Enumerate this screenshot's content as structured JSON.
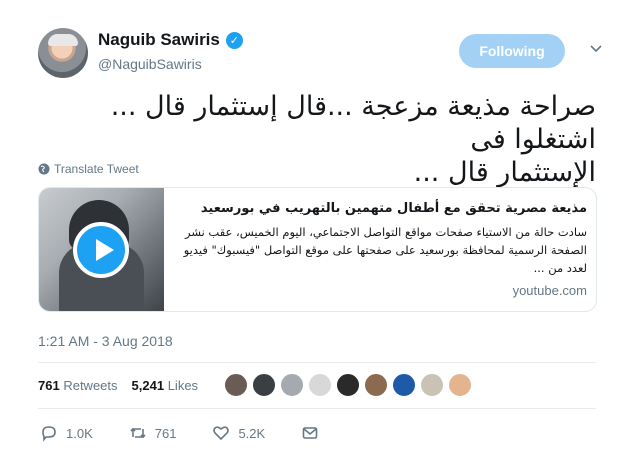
{
  "tweet": {
    "author": {
      "display_name": "Naguib Sawiris",
      "handle": "@NaguibSawiris",
      "verified": true
    },
    "follow_button_label": "Following",
    "text_line1": "صراحة مذيعة مزعجة ...قال إستثمار قال ... اشتغلوا فى",
    "text_line2": "الإستثمار قال ...",
    "translate_label": "Translate Tweet",
    "card": {
      "title": "مذيعة مصرية تحقق مع أطفال متهمين بالتهريب في بورسعيد",
      "description": "سادت حالة من الاستياء صفحات مواقع التواصل الاجتماعي، اليوم الخميس، عقب نشر الصفحة الرسمية لمحافظة بورسعيد على صفحتها على موقع التواصل \"فيسبوك\" فيديو لعدد من ...",
      "domain": "youtube.com"
    },
    "timestamp": "1:21 AM - 3 Aug 2018",
    "stats": {
      "retweets_count": "761",
      "retweets_label": "Retweets",
      "likes_count": "5,241",
      "likes_label": "Likes"
    },
    "liker_avatar_colors": [
      "#6b5b55",
      "#3a3f44",
      "#a5aab0",
      "#d8d8d8",
      "#2a2a2a",
      "#8b6a4f",
      "#1e5aa8",
      "#c9c2b5",
      "#e3b48e"
    ],
    "actions": {
      "reply_count": "1.0K",
      "retweet_count": "761",
      "like_count": "5.2K"
    }
  },
  "colors": {
    "accent": "#1da1f2",
    "follow_button_bg": "#a3d1f5",
    "secondary_text": "#657786"
  }
}
